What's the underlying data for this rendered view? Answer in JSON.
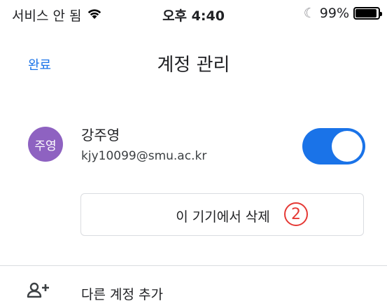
{
  "status_bar": {
    "carrier": "서비스 안 됨",
    "time": "오후 4:40",
    "battery_percent_text": "99%",
    "battery_level": 0.99,
    "wifi_icon": "wifi-icon",
    "moon_icon": "moon-icon"
  },
  "nav": {
    "done_label": "완료",
    "title": "계정 관리"
  },
  "account": {
    "avatar_text": "주영",
    "name": "강주영",
    "email": "kjy10099@smu.ac.kr",
    "toggle_on": true
  },
  "remove_button": {
    "label": "이 기기에서 삭제",
    "annotation": "2"
  },
  "add_account": {
    "label": "다른 계정 추가",
    "icon": "add-person-icon"
  },
  "colors": {
    "accent": "#1a73e8",
    "avatar": "#8e62c1",
    "annotation": "#e53935"
  }
}
